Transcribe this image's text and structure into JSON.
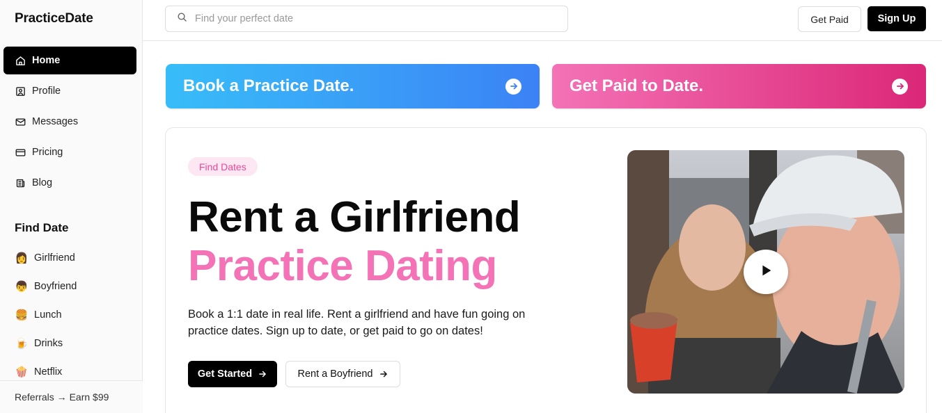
{
  "brand": "PracticeDate",
  "nav": {
    "items": [
      {
        "label": "Home",
        "icon": "home-icon",
        "active": true
      },
      {
        "label": "Profile",
        "icon": "profile-icon"
      },
      {
        "label": "Messages",
        "icon": "mail-icon"
      },
      {
        "label": "Pricing",
        "icon": "credit-card-icon"
      },
      {
        "label": "Blog",
        "icon": "newspaper-icon"
      }
    ]
  },
  "find": {
    "title": "Find Date",
    "items": [
      {
        "emoji": "👩",
        "label": "Girlfriend"
      },
      {
        "emoji": "👦",
        "label": "Boyfriend"
      },
      {
        "emoji": "🍔",
        "label": "Lunch"
      },
      {
        "emoji": "🍺",
        "label": "Drinks"
      },
      {
        "emoji": "🍿",
        "label": "Netflix"
      }
    ]
  },
  "footer": {
    "referral": "Referrals → Earn $99"
  },
  "header": {
    "search_placeholder": "Find your perfect date",
    "get_paid_label": "Get Paid",
    "sign_up_label": "Sign Up"
  },
  "banners": {
    "book": "Book a Practice Date.",
    "paid": "Get Paid to Date."
  },
  "hero": {
    "badge": "Find Dates",
    "title_line1": "Rent a Girlfriend",
    "title_line2": "Practice Dating",
    "description": "Book a 1:1 date in real life. Rent a girlfriend and have fun going on practice dates. Sign up to date, or get paid to go on dates!",
    "primary_cta": "Get Started",
    "secondary_cta": "Rent a Boyfriend"
  },
  "colors": {
    "accent_pink": "#f472b6",
    "blue_gradient_start": "#38bdf8",
    "blue_gradient_end": "#3b82f6",
    "pink_gradient_start": "#f472b6",
    "pink_gradient_end": "#db2777"
  }
}
